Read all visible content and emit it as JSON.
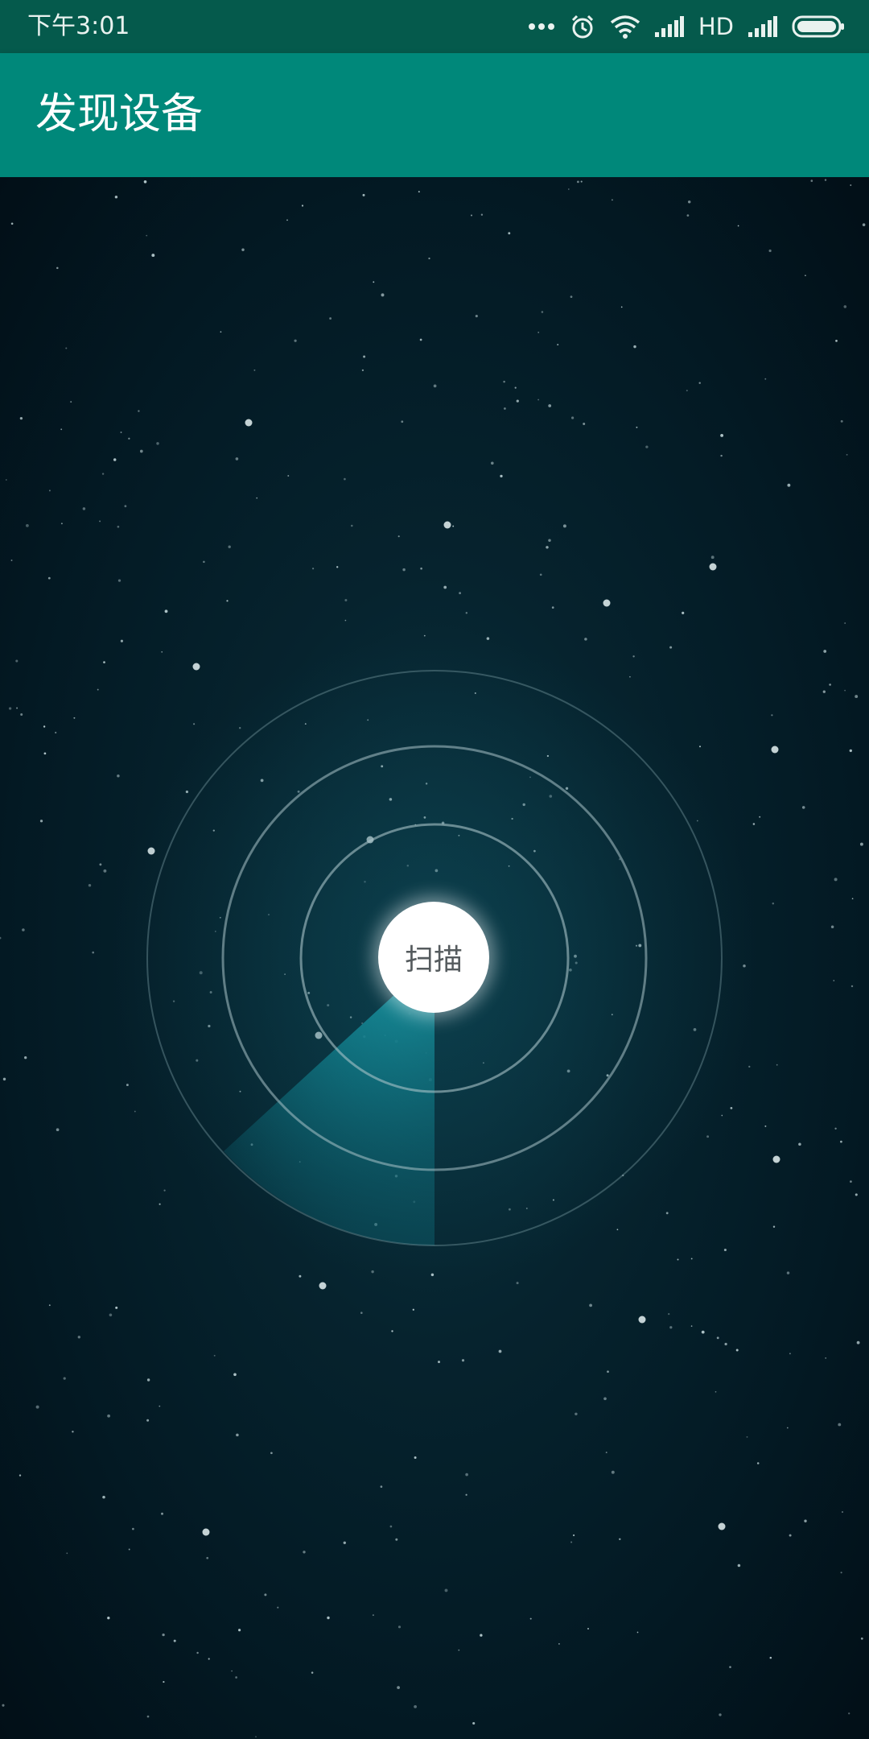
{
  "status_bar": {
    "time": "下午3:01",
    "network_label": "HD",
    "icons": [
      "more-dots-icon",
      "alarm-icon",
      "wifi-icon",
      "signal-icon",
      "signal-icon",
      "battery-icon"
    ]
  },
  "app_bar": {
    "title": "发现设备"
  },
  "scanner": {
    "button_label": "扫描"
  },
  "colors": {
    "status_bar": "#055a4c",
    "app_bar": "#00887a",
    "background": "#021821",
    "sweep": "#1aa3b0",
    "ring": "#a9c3c8"
  }
}
